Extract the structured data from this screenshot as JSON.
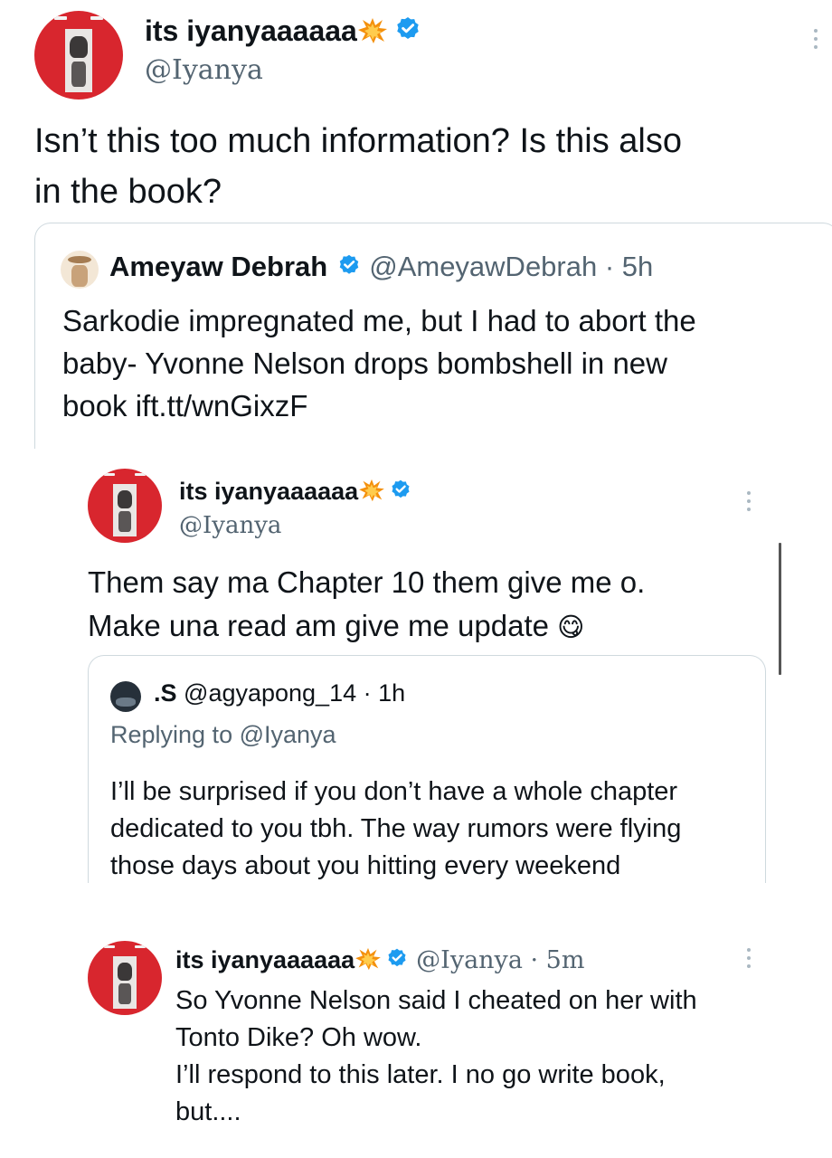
{
  "tweet1": {
    "name": "its iyanyaaaaaa",
    "handle": "@Iyanya",
    "text": "Isn’t this too much information? Is this also\nin the book?",
    "quote": {
      "name": "Ameyaw Debrah",
      "handle": "@AmeyawDebrah · 5h",
      "text": "Sarkodie impregnated me, but I had to abort the\nbaby- Yvonne Nelson drops bombshell in new\nbook ift.tt/wnGixzF"
    }
  },
  "tweet2": {
    "name": "its iyanyaaaaaa",
    "handle": "@Iyanya",
    "text": "Them say ma Chapter 10 them give me o.\nMake una read am give me update",
    "emoji": "😋",
    "quote": {
      "name": ".S",
      "handle": "@agyapong_14 · 1h",
      "replying": "Replying to @Iyanya",
      "text": "I’ll be surprised if you don’t have a whole chapter\ndedicated to you tbh. The way rumors were flying\nthose days about you hitting every weekend"
    }
  },
  "tweet3": {
    "name": "its iyanyaaaaaa",
    "handle": "@Iyanya · 5m",
    "text": "So Yvonne Nelson said I cheated on her with\nTonto Dike? Oh wow.\nI’ll respond to this later. I no go write book,\nbut...."
  },
  "colors": {
    "verified": "#1d9bf0",
    "avatar": "#d8262e",
    "muted": "#536471"
  },
  "icons": [
    "verified-badge-icon",
    "explosion-icon",
    "more-icon",
    "face-savoring-food-emoji"
  ]
}
